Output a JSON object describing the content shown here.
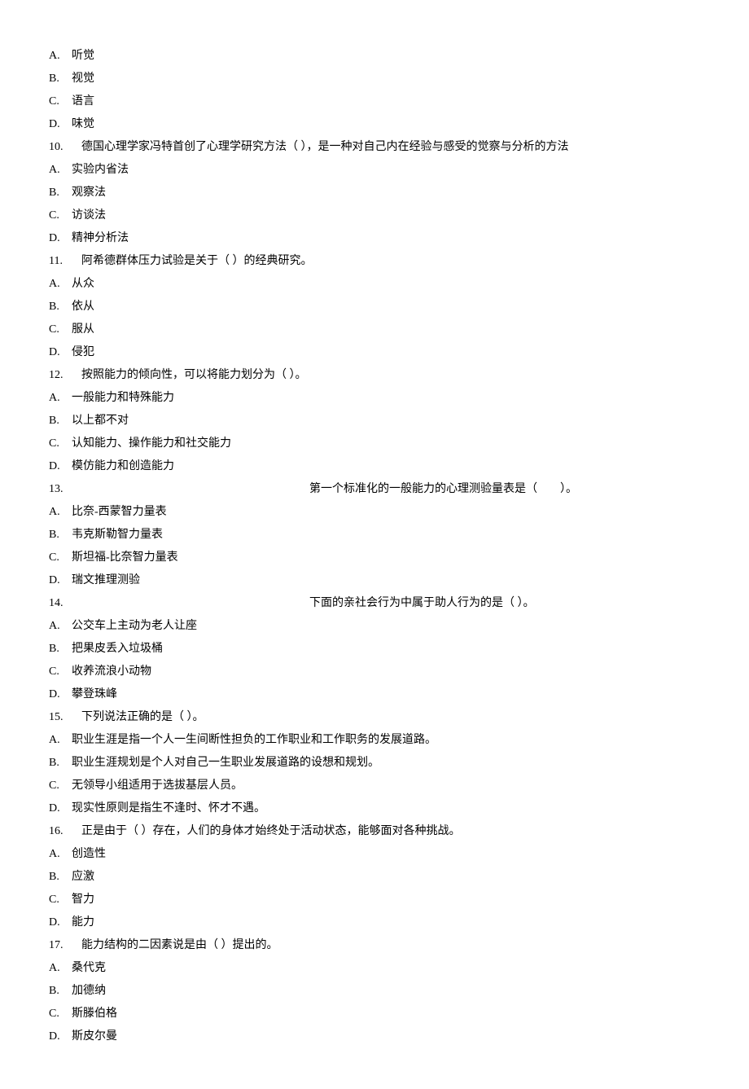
{
  "lines": [
    {
      "type": "option",
      "label": "A.",
      "text": "听觉"
    },
    {
      "type": "option",
      "label": "B.",
      "text": "视觉"
    },
    {
      "type": "option",
      "label": "C.",
      "text": "语言"
    },
    {
      "type": "option",
      "label": "D.",
      "text": "味觉"
    },
    {
      "type": "question",
      "num": "10.",
      "text": "德国心理学家冯特首创了心理学研究方法（ ），是一种对自己内在经验与感受的觉察与分析的方法"
    },
    {
      "type": "option",
      "label": "A.",
      "text": "实验内省法"
    },
    {
      "type": "option",
      "label": "B.",
      "text": "观察法"
    },
    {
      "type": "option",
      "label": "C.",
      "text": "访谈法"
    },
    {
      "type": "option",
      "label": "D.",
      "text": "精神分析法"
    },
    {
      "type": "question",
      "num": "11.",
      "text": "阿希德群体压力试验是关于（ ）的经典研究。"
    },
    {
      "type": "option",
      "label": "A.",
      "text": "从众"
    },
    {
      "type": "option",
      "label": "B.",
      "text": "依从"
    },
    {
      "type": "option",
      "label": "C.",
      "text": "服从"
    },
    {
      "type": "option",
      "label": "D.",
      "text": "侵犯"
    },
    {
      "type": "question",
      "num": "12.",
      "text": "按照能力的倾向性，可以将能力划分为（ ）。"
    },
    {
      "type": "option",
      "label": "A.",
      "text": "一般能力和特殊能力"
    },
    {
      "type": "option",
      "label": "B.",
      "text": "以上都不对"
    },
    {
      "type": "option",
      "label": "C.",
      "text": "认知能力、操作能力和社交能力"
    },
    {
      "type": "option",
      "label": "D.",
      "text": "模仿能力和创造能力"
    },
    {
      "type": "question-centered",
      "class": "q13",
      "num": "13.",
      "text": "第一个标准化的一般能力的心理测验量表是（　　）。"
    },
    {
      "type": "option",
      "label": "A.",
      "text": "比奈-西蒙智力量表"
    },
    {
      "type": "option",
      "label": "B.",
      "text": "韦克斯勒智力量表"
    },
    {
      "type": "option",
      "label": "C.",
      "text": "斯坦福-比奈智力量表"
    },
    {
      "type": "option",
      "label": "D.",
      "text": "瑞文推理测验"
    },
    {
      "type": "question-centered",
      "class": "q14",
      "num": "14.",
      "text": "下面的亲社会行为中属于助人行为的是（ ）。"
    },
    {
      "type": "option",
      "label": "A.",
      "text": "公交车上主动为老人让座"
    },
    {
      "type": "option",
      "label": "B.",
      "text": "把果皮丢入垃圾桶"
    },
    {
      "type": "option",
      "label": "C.",
      "text": "收养流浪小动物"
    },
    {
      "type": "option",
      "label": "D.",
      "text": "攀登珠峰"
    },
    {
      "type": "question",
      "num": "15.",
      "text": "下列说法正确的是（ ）。"
    },
    {
      "type": "option",
      "label": "A.",
      "text": "职业生涯是指一个人一生间断性担负的工作职业和工作职务的发展道路。"
    },
    {
      "type": "option",
      "label": "B.",
      "text": "职业生涯规划是个人对自己一生职业发展道路的设想和规划。"
    },
    {
      "type": "option",
      "label": "C.",
      "text": "无领导小组适用于选拔基层人员。"
    },
    {
      "type": "option",
      "label": "D.",
      "text": "现实性原则是指生不逢时、怀才不遇。"
    },
    {
      "type": "question",
      "num": "16.",
      "text": "正是由于（ ）存在，人们的身体才始终处于活动状态，能够面对各种挑战。"
    },
    {
      "type": "option",
      "label": "A.",
      "text": "创造性"
    },
    {
      "type": "option",
      "label": "B.",
      "text": "应激"
    },
    {
      "type": "option",
      "label": "C.",
      "text": "智力"
    },
    {
      "type": "option",
      "label": "D.",
      "text": "能力"
    },
    {
      "type": "question",
      "num": "17.",
      "text": "能力结构的二因素说是由（ ）提出的。"
    },
    {
      "type": "option",
      "label": "A.",
      "text": "桑代克"
    },
    {
      "type": "option",
      "label": "B.",
      "text": "加德纳"
    },
    {
      "type": "option",
      "label": "C.",
      "text": "斯滕伯格"
    },
    {
      "type": "option",
      "label": "D.",
      "text": "斯皮尔曼"
    }
  ]
}
